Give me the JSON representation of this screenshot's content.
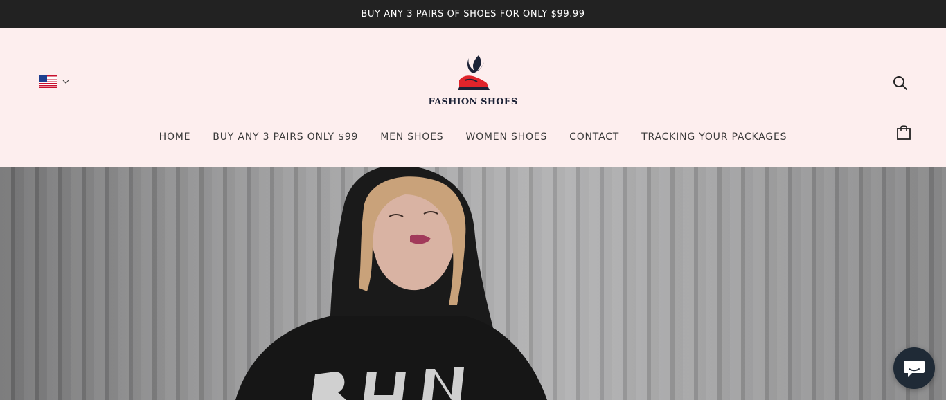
{
  "announcement": {
    "text": "BUY ANY 3 PAIRS OF SHOES FOR ONLY $99.99"
  },
  "header": {
    "locale": {
      "country": "United States",
      "flag_icon": "us-flag-icon"
    },
    "logo": {
      "text": "FASHION SHOES"
    },
    "search_icon": "search-icon",
    "cart_icon": "shopping-bag-icon"
  },
  "nav": {
    "items": [
      {
        "label": "HOME"
      },
      {
        "label": "BUY ANY 3 PAIRS ONLY $99"
      },
      {
        "label": "MEN SHOES"
      },
      {
        "label": "WOMEN SHOES"
      },
      {
        "label": "CONTACT"
      },
      {
        "label": "TRACKING YOUR PACKAGES"
      }
    ]
  },
  "hero": {
    "image": "woman-in-black-hoodie-photo"
  },
  "chat": {
    "icon": "chat-bubble-icon"
  },
  "colors": {
    "announcement_bg": "#222222",
    "header_bg": "#fdeeee",
    "chat_bg": "#1f2a36",
    "logo_red": "#e0242b",
    "logo_navy": "#1c2236"
  }
}
